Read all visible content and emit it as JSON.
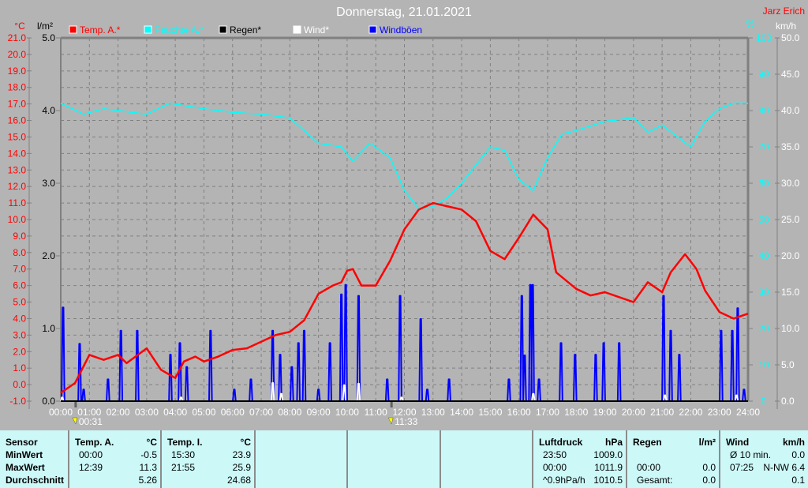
{
  "header": {
    "title": "Donnerstag, 21.01.2021",
    "author": "Jarz Erich"
  },
  "colors": {
    "temp": "#ff0000",
    "humidity": "#00ffff",
    "rain": "#000000",
    "wind": "#ffffff",
    "gust": "#0000ff",
    "background": "#b4b4b4",
    "panel": "#ccf8f8"
  },
  "chart_data": {
    "type": "line",
    "title": "Donnerstag, 21.01.2021",
    "grid": true,
    "legend_position": "top",
    "legend": [
      {
        "label": "Temp. A.*",
        "color": "#ff0000"
      },
      {
        "label": "Feuchte A.*",
        "color": "#00ffff"
      },
      {
        "label": "Regen*",
        "color": "#000000"
      },
      {
        "label": "Wind*",
        "color": "#ffffff"
      },
      {
        "label": "Windböen",
        "color": "#0000ff"
      }
    ],
    "axes": {
      "temp": {
        "unit": "°C",
        "range": [
          -1,
          21
        ],
        "ticks": [
          "-1.0",
          "0.0",
          "1.0",
          "2.0",
          "3.0",
          "4.0",
          "5.0",
          "6.0",
          "7.0",
          "8.0",
          "9.0",
          "10.0",
          "11.0",
          "12.0",
          "13.0",
          "14.0",
          "15.0",
          "16.0",
          "17.0",
          "18.0",
          "19.0",
          "20.0",
          "21.0"
        ]
      },
      "rain": {
        "unit": "l/m²",
        "range": [
          0,
          5
        ],
        "ticks": [
          "0.0",
          "1.0",
          "2.0",
          "3.0",
          "4.0",
          "5.0"
        ]
      },
      "humidity": {
        "unit": "%",
        "range": [
          0,
          100
        ],
        "ticks": [
          "0",
          "10",
          "20",
          "30",
          "40",
          "50",
          "60",
          "70",
          "80",
          "90",
          "100"
        ]
      },
      "wind": {
        "unit": "km/h",
        "range": [
          0,
          50
        ],
        "ticks": [
          "0.0",
          "5.0",
          "10.0",
          "15.0",
          "20.0",
          "25.0",
          "30.0",
          "35.0",
          "40.0",
          "45.0",
          "50.0"
        ]
      },
      "x": {
        "range": [
          0,
          24
        ],
        "ticks": [
          "00:00",
          "01:00",
          "02:00",
          "03:00",
          "04:00",
          "05:00",
          "06:00",
          "07:00",
          "08:00",
          "09:00",
          "10:00",
          "11:00",
          "12:00",
          "13:00",
          "14:00",
          "15:00",
          "16:00",
          "17:00",
          "18:00",
          "19:00",
          "20:00",
          "21:00",
          "22:00",
          "23:00",
          "24:00"
        ]
      }
    },
    "markers": [
      {
        "time": 0.52,
        "label": "00:31",
        "kind": "moonset"
      },
      {
        "time": 11.55,
        "label": "11:33",
        "kind": "moonrise"
      }
    ],
    "series": [
      {
        "name": "Temp. A.",
        "axis": "temp",
        "x": [
          0,
          0.5,
          1,
          1.5,
          2,
          2.3,
          3,
          3.5,
          4,
          4.3,
          4.7,
          5,
          5.5,
          6,
          6.5,
          7,
          7.5,
          8,
          8.5,
          9,
          9.5,
          9.8,
          10,
          10.2,
          10.5,
          11,
          11.5,
          12,
          12.5,
          13,
          13.5,
          14,
          14.5,
          15,
          15.5,
          16,
          16.5,
          17,
          17.3,
          18,
          18.5,
          19,
          19.5,
          20,
          20.5,
          21,
          21.3,
          21.8,
          22.2,
          22.5,
          23,
          23.5,
          24
        ],
        "y": [
          -0.5,
          0.1,
          1.8,
          1.5,
          1.8,
          1.3,
          2.2,
          0.9,
          0.4,
          1.4,
          1.7,
          1.4,
          1.7,
          2.1,
          2.2,
          2.6,
          3.0,
          3.2,
          3.9,
          5.5,
          6.0,
          6.2,
          6.9,
          7.0,
          6.0,
          6.0,
          7.5,
          9.4,
          10.6,
          11.0,
          10.8,
          10.6,
          9.9,
          8.1,
          7.6,
          8.9,
          10.3,
          9.4,
          6.8,
          5.8,
          5.4,
          5.6,
          5.3,
          5.0,
          6.2,
          5.6,
          6.8,
          7.9,
          7.0,
          5.7,
          4.4,
          4.0,
          4.3
        ]
      },
      {
        "name": "Feuchte A.",
        "axis": "humidity",
        "x": [
          0,
          0.8,
          1.5,
          3,
          3.8,
          5,
          6,
          7,
          8,
          9,
          9.8,
          10.2,
          10.8,
          11.5,
          12,
          12.5,
          13,
          13.5,
          14,
          15,
          15.5,
          16,
          16.5,
          17,
          17.5,
          18,
          19,
          20,
          20.5,
          21,
          21.5,
          22,
          22.5,
          23,
          23.5,
          24
        ],
        "y": [
          82,
          79,
          80.5,
          79,
          82,
          80.5,
          79.5,
          79,
          78,
          71,
          70,
          66,
          71,
          67,
          58,
          53,
          53.5,
          56,
          60,
          70,
          69,
          61,
          58,
          67,
          73.5,
          74.5,
          77,
          78,
          74,
          76,
          73,
          70,
          77,
          80.5,
          82,
          82
        ]
      },
      {
        "name": "Regen",
        "axis": "rain",
        "x": [
          0,
          24
        ],
        "y": [
          0,
          0
        ]
      },
      {
        "name": "Wind",
        "axis": "wind",
        "spikes": [
          [
            0.05,
            0.5
          ],
          [
            4.2,
            0.5
          ],
          [
            7.4,
            2.5
          ],
          [
            7.7,
            1.0
          ],
          [
            9.9,
            2.2
          ],
          [
            10.4,
            2.4
          ],
          [
            11.9,
            0.5
          ],
          [
            16.5,
            1.0
          ],
          [
            21.1,
            0.8
          ],
          [
            23.6,
            0.8
          ]
        ]
      },
      {
        "name": "Windböen",
        "axis": "wind",
        "spikes": [
          [
            0.08,
            12.9
          ],
          [
            0.66,
            7.9
          ],
          [
            0.8,
            1.6
          ],
          [
            1.65,
            3
          ],
          [
            2.1,
            9.7
          ],
          [
            2.67,
            9.7
          ],
          [
            3.83,
            6.4
          ],
          [
            4.16,
            8
          ],
          [
            4.4,
            4.7
          ],
          [
            5.23,
            9.7
          ],
          [
            6.06,
            1.6
          ],
          [
            6.64,
            3
          ],
          [
            7.4,
            9.7
          ],
          [
            7.66,
            6.4
          ],
          [
            8.07,
            4.7
          ],
          [
            8.3,
            8
          ],
          [
            8.5,
            9.7
          ],
          [
            9.0,
            1.6
          ],
          [
            9.4,
            8
          ],
          [
            9.8,
            14.7
          ],
          [
            9.95,
            16
          ],
          [
            10.4,
            14.5
          ],
          [
            11.4,
            3
          ],
          [
            11.85,
            14.5
          ],
          [
            12.57,
            11.3
          ],
          [
            12.8,
            1.6
          ],
          [
            13.56,
            3
          ],
          [
            15.65,
            3
          ],
          [
            16.1,
            14.5
          ],
          [
            16.2,
            6.3
          ],
          [
            16.4,
            16
          ],
          [
            16.48,
            16
          ],
          [
            16.7,
            3
          ],
          [
            17.47,
            8
          ],
          [
            17.96,
            6.4
          ],
          [
            18.68,
            6.4
          ],
          [
            18.96,
            8
          ],
          [
            19.5,
            8
          ],
          [
            21.05,
            14.5
          ],
          [
            21.3,
            9.7
          ],
          [
            21.6,
            6.4
          ],
          [
            23.06,
            9.7
          ],
          [
            23.45,
            9.7
          ],
          [
            23.64,
            12.8
          ],
          [
            23.86,
            1.6
          ]
        ]
      }
    ]
  },
  "table": {
    "columns": [
      {
        "id": "sensor",
        "rows": [
          [
            "Sensor",
            ""
          ],
          [
            "MinWert",
            ""
          ],
          [
            "MaxWert",
            ""
          ],
          [
            "Durchschnitt",
            ""
          ]
        ],
        "bold": true
      },
      {
        "id": "temp-a",
        "rows": [
          [
            "Temp. A.",
            "°C"
          ],
          [
            "00:00",
            "-0.5"
          ],
          [
            "12:39",
            "11.3"
          ],
          [
            "",
            "5.26"
          ]
        ]
      },
      {
        "id": "temp-i",
        "rows": [
          [
            "Temp. I.",
            "°C"
          ],
          [
            "15:30",
            "23.9"
          ],
          [
            "21:55",
            "25.9"
          ],
          [
            "",
            "24.68"
          ]
        ]
      },
      {
        "id": "empty-1",
        "rows": []
      },
      {
        "id": "empty-2",
        "rows": []
      },
      {
        "id": "empty-3",
        "rows": []
      },
      {
        "id": "luftdruck",
        "rows": [
          [
            "Luftdruck",
            "hPa"
          ],
          [
            "23:50",
            "1009.0"
          ],
          [
            "00:00",
            "1011.9"
          ],
          [
            "^0.9hPa/h",
            "1010.5"
          ]
        ]
      },
      {
        "id": "regen",
        "rows": [
          [
            "Regen",
            "l/m²"
          ],
          [
            "",
            ""
          ],
          [
            "00:00",
            "0.0"
          ],
          [
            "Gesamt:",
            "0.0"
          ]
        ]
      },
      {
        "id": "wind",
        "rows": [
          [
            "Wind",
            "km/h"
          ],
          [
            "Ø 10 min.",
            "0.0"
          ],
          [
            "07:25",
            "N-NW 6.4"
          ],
          [
            "",
            "0.1"
          ]
        ]
      }
    ]
  }
}
